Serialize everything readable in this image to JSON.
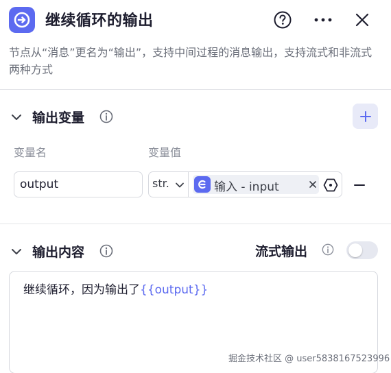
{
  "header": {
    "title": "继续循环的输出"
  },
  "description": "节点从“消息”更名为“输出”，支持中间过程的消息输出，支持流式和非流式两种方式",
  "output_variables": {
    "title": "输出变量",
    "col_name_label": "变量名",
    "col_value_label": "变量值",
    "row": {
      "name_value": "output",
      "type_label": "str.",
      "reference_label": "输入 - input"
    }
  },
  "output_content": {
    "title": "输出内容",
    "streaming_label": "流式输出",
    "streaming_enabled": false,
    "content_text": "继续循环，因为输出了",
    "content_variable": "{{output}}"
  },
  "watermark": "掘金技术社区 @ user5838167523996",
  "colors": {
    "accent": "#5c6af0",
    "text": "#1d1d2e",
    "muted": "#6b6f7a"
  }
}
